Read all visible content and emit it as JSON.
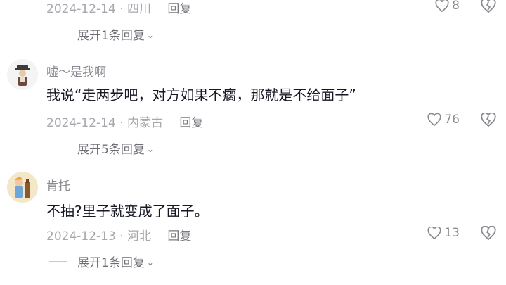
{
  "top": {
    "meta_date": "2024-12-14",
    "meta_location": "四川",
    "reply_label": "回复",
    "like_count": "8",
    "expand_text": "展开1条回复"
  },
  "comments": [
    {
      "username": "嘘～是我啊",
      "text": "我说“走两步吧，对方如果不瘸，那就是不给面子”",
      "date": "2024-12-14",
      "location": "内蒙古",
      "reply_label": "回复",
      "like_count": "76",
      "expand_text": "展开5条回复"
    },
    {
      "username": "肯托",
      "text": "不抽?里子就变成了面子。",
      "date": "2024-12-13",
      "location": "河北",
      "reply_label": "回复",
      "like_count": "13",
      "expand_text": "展开1条回复"
    }
  ],
  "icons": {
    "like": "heart-outline-icon",
    "dislike": "broken-heart-icon",
    "expand": "chevron-down-icon"
  },
  "colors": {
    "meta": "#a7a8ad",
    "text": "#161823",
    "icon": "#8a8b90"
  }
}
